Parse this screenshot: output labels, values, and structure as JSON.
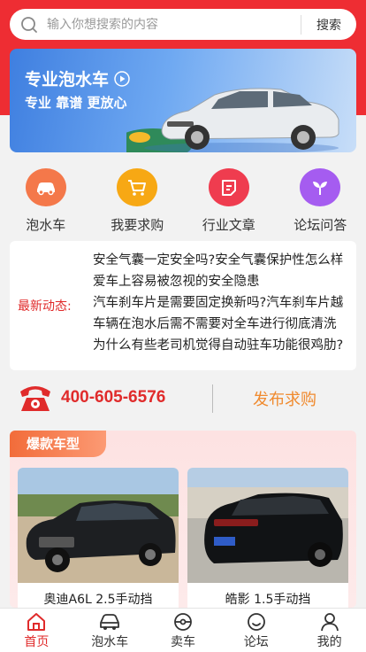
{
  "search": {
    "placeholder": "输入你想搜索的内容",
    "button": "搜索"
  },
  "banner": {
    "title": "专业泡水车",
    "subtitle": "专业 靠谱 更放心"
  },
  "quick_nav": [
    {
      "label": "泡水车",
      "icon": "car-icon",
      "color": "#f4784a"
    },
    {
      "label": "我要求购",
      "icon": "cart-icon",
      "color": "#f7a814"
    },
    {
      "label": "行业文章",
      "icon": "article-icon",
      "color": "#ef3c4f"
    },
    {
      "label": "论坛问答",
      "icon": "sprout-icon",
      "color": "#a55cf0"
    }
  ],
  "news": {
    "label": "最新动态:",
    "items": [
      "安全气囊一定安全吗?安全气囊保护性怎么样",
      "爱车上容易被忽视的安全隐患",
      "汽车刹车片是需要固定换新吗?汽车刹车片越",
      "车辆在泡水后需不需要对全车进行彻底清洗",
      "为什么有些老司机觉得自动驻车功能很鸡肋?"
    ]
  },
  "contact": {
    "phone": "400-605-6576",
    "publish": "发布求购"
  },
  "hot": {
    "title": "爆款车型",
    "cars": [
      {
        "name": "奥迪A6L 2.5手动挡"
      },
      {
        "name": "皓影 1.5手动挡"
      }
    ]
  },
  "tabbar": [
    {
      "label": "首页",
      "icon": "home-icon",
      "active": true
    },
    {
      "label": "泡水车",
      "icon": "car-icon",
      "active": false
    },
    {
      "label": "卖车",
      "icon": "sell-icon",
      "active": false
    },
    {
      "label": "论坛",
      "icon": "forum-icon",
      "active": false
    },
    {
      "label": "我的",
      "icon": "user-icon",
      "active": false
    }
  ],
  "colors": {
    "brand": "#ee2d33",
    "accent_orange": "#f08a2e"
  }
}
